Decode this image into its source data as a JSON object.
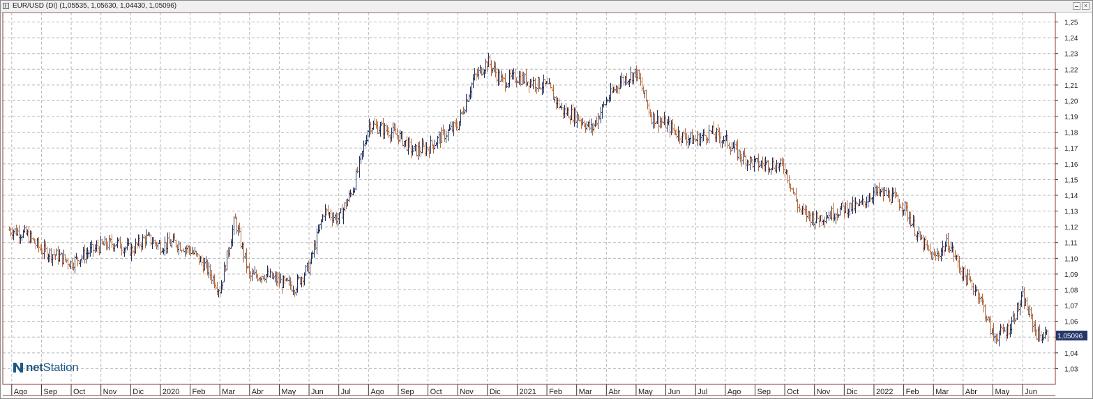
{
  "window": {
    "title": "EUR/USD (DI) (1,05535, 1,05630, 1,04430, 1,05096)",
    "restore_icon": "restore-icon",
    "close_icon": "close-icon"
  },
  "logo": {
    "prefix": "net",
    "suffix": "Station",
    "color": "#1d5a86"
  },
  "colors": {
    "up": "#1f2f5c",
    "down": "#b5683a",
    "grid": "#b8b8b8",
    "frame": "#8b3a3a",
    "badge": "#243766"
  },
  "chart_data": {
    "type": "ohlc",
    "title": "EUR/USD (DI)",
    "last_ohlc": {
      "open": 1.05535,
      "high": 1.0563,
      "low": 1.0443,
      "close": 1.05096
    },
    "last_price_label": "1,05096",
    "y_axis": {
      "position": "right",
      "ylim": [
        1.02,
        1.256
      ],
      "ticks": [
        1.03,
        1.04,
        1.05,
        1.06,
        1.07,
        1.08,
        1.09,
        1.1,
        1.11,
        1.12,
        1.13,
        1.14,
        1.15,
        1.16,
        1.17,
        1.18,
        1.19,
        1.2,
        1.21,
        1.22,
        1.23,
        1.24,
        1.25
      ],
      "tick_labels": [
        "1,03",
        "1,04",
        "1,05",
        "1,06",
        "1,07",
        "1,08",
        "1,09",
        "1,10",
        "1,11",
        "1,12",
        "1,13",
        "1,14",
        "1,15",
        "1,16",
        "1,17",
        "1,18",
        "1,19",
        "1,20",
        "1,21",
        "1,22",
        "1,23",
        "1,24",
        "1,25"
      ]
    },
    "x_axis": {
      "labels": [
        "Ago",
        "Sep",
        "Oct",
        "Nov",
        "Dic",
        "2020",
        "Feb",
        "Mar",
        "Abr",
        "May",
        "Jun",
        "Jul",
        "Ago",
        "Sep",
        "Oct",
        "Nov",
        "Dic",
        "2021",
        "Feb",
        "Mar",
        "Abr",
        "May",
        "Jun",
        "Jul",
        "Ago",
        "Sep",
        "Oct",
        "Nov",
        "Dic",
        "2022",
        "Feb",
        "Mar",
        "Abr",
        "May",
        "Jun"
      ],
      "label_month_index": [
        0,
        1,
        2,
        3,
        4,
        5,
        6,
        7,
        8,
        9,
        10,
        11,
        12,
        13,
        14,
        15,
        16,
        17,
        18,
        19,
        20,
        21,
        22,
        23,
        24,
        25,
        26,
        27,
        28,
        29,
        30,
        31,
        32,
        33,
        34
      ],
      "range_months": [
        -0.3,
        35.1
      ]
    },
    "grid": true,
    "series": [
      {
        "month_index": [
          0,
          0.5,
          1,
          1.5,
          2,
          2.5,
          3,
          3.5,
          4,
          4.5,
          5,
          5.5,
          6,
          6.5,
          7,
          7.5,
          8,
          8.5,
          9,
          9.5,
          10,
          10.5,
          11,
          11.5,
          12,
          12.5,
          13,
          13.5,
          14,
          14.5,
          15,
          15.5,
          16,
          16.5,
          17,
          17.5,
          18,
          18.5,
          19,
          19.5,
          20,
          20.5,
          21,
          21.5,
          22,
          22.5,
          23,
          23.5,
          24,
          24.5,
          25,
          25.5,
          26,
          26.5,
          27,
          27.5,
          28,
          28.5,
          29,
          29.5,
          30,
          30.5,
          31,
          31.5,
          32,
          32.5,
          33,
          33.5,
          34,
          34.5
        ],
        "close": [
          1.118,
          1.115,
          1.105,
          1.102,
          1.097,
          1.103,
          1.108,
          1.11,
          1.105,
          1.113,
          1.108,
          1.11,
          1.105,
          1.095,
          1.08,
          1.125,
          1.088,
          1.09,
          1.085,
          1.082,
          1.095,
          1.13,
          1.125,
          1.145,
          1.185,
          1.182,
          1.178,
          1.168,
          1.17,
          1.178,
          1.185,
          1.213,
          1.225,
          1.212,
          1.215,
          1.212,
          1.209,
          1.194,
          1.19,
          1.182,
          1.2,
          1.213,
          1.218,
          1.19,
          1.185,
          1.178,
          1.175,
          1.18,
          1.175,
          1.165,
          1.16,
          1.16,
          1.158,
          1.13,
          1.125,
          1.128,
          1.132,
          1.133,
          1.142,
          1.14,
          1.133,
          1.113,
          1.1,
          1.11,
          1.09,
          1.078,
          1.05,
          1.055,
          1.075,
          1.051
        ]
      }
    ]
  }
}
